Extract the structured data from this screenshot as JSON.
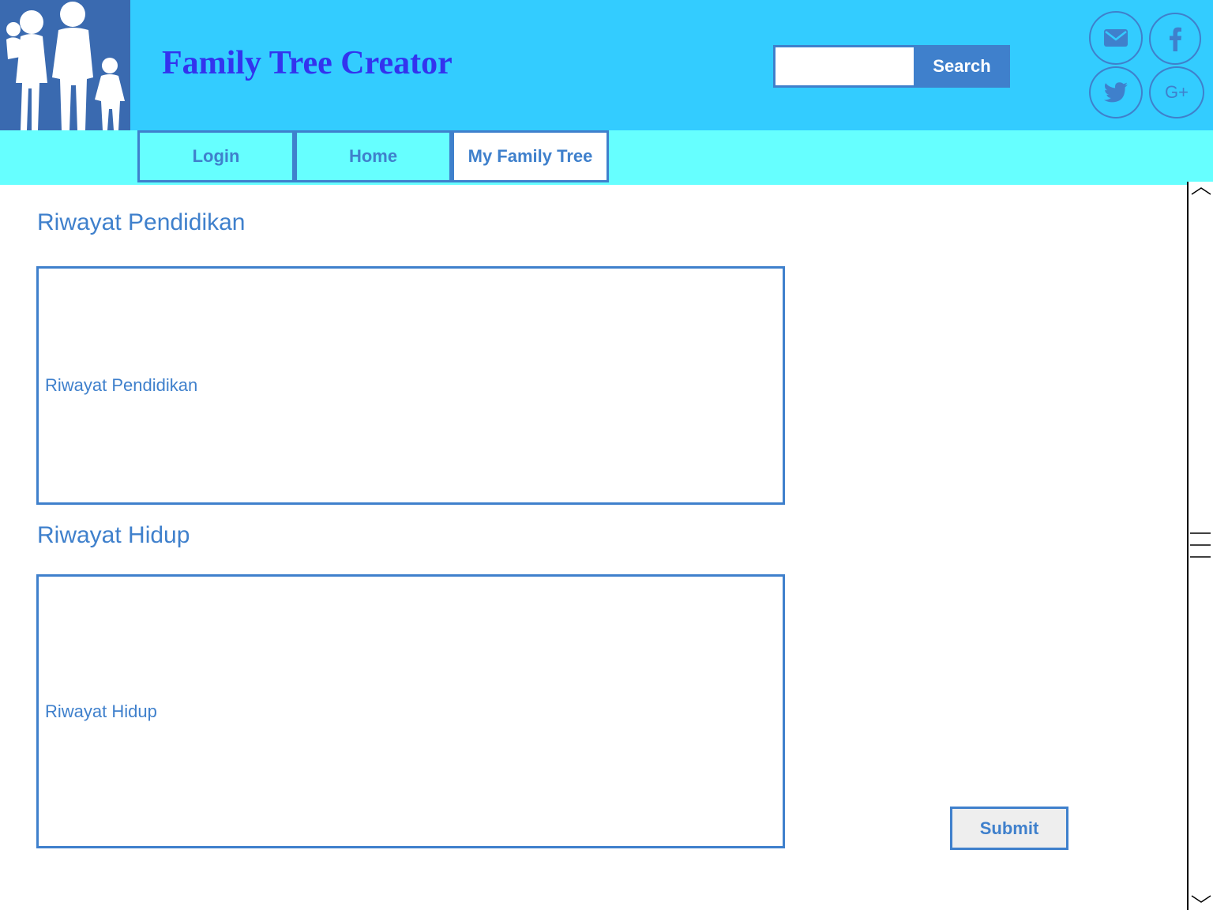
{
  "header": {
    "title": "Family Tree Creator",
    "logo": "family-silhouette-icon",
    "search": {
      "value": "",
      "placeholder": "",
      "button_label": "Search"
    },
    "social": [
      {
        "icon": "mail-icon"
      },
      {
        "icon": "facebook-icon"
      },
      {
        "icon": "twitter-icon"
      },
      {
        "icon": "google-plus-icon",
        "label": "G+"
      }
    ]
  },
  "nav": {
    "items": [
      {
        "label": "Login"
      },
      {
        "label": "Home"
      },
      {
        "label": "My Family Tree",
        "active": true
      }
    ]
  },
  "main": {
    "education": {
      "heading": "Riwayat Pendidikan",
      "field_text": "Riwayat Pendidikan"
    },
    "biography": {
      "heading": "Riwayat Hidup",
      "field_text": "Riwayat Hidup"
    },
    "submit_label": "Submit"
  },
  "colors": {
    "header_bg": "#33ccff",
    "nav_bg": "#66ffff",
    "accent": "#3f80cc",
    "title": "#3333ee",
    "logo_bg": "#3a6ab0"
  }
}
